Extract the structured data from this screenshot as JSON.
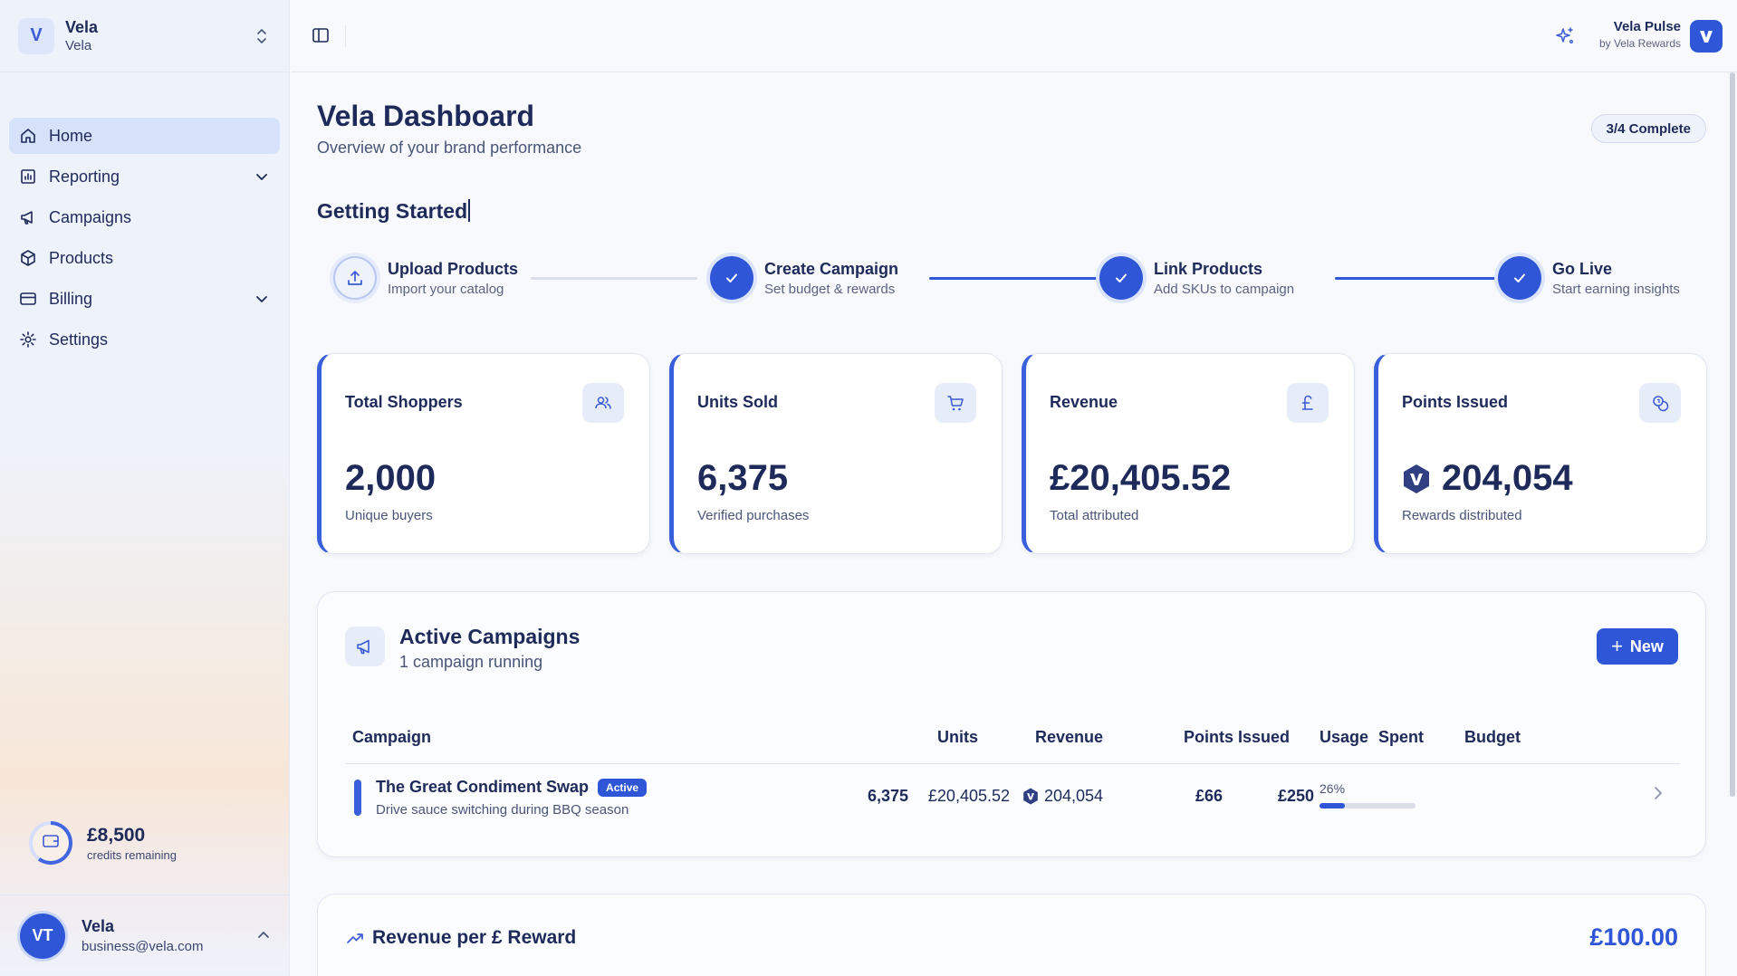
{
  "sidebar": {
    "brand": {
      "initial": "V",
      "name": "Vela",
      "sub": "Vela"
    },
    "nav": [
      {
        "label": "Home",
        "icon": "home-icon"
      },
      {
        "label": "Reporting",
        "icon": "report-icon"
      },
      {
        "label": "Campaigns",
        "icon": "megaphone-icon"
      },
      {
        "label": "Products",
        "icon": "package-icon"
      },
      {
        "label": "Billing",
        "icon": "credit-card-icon"
      },
      {
        "label": "Settings",
        "icon": "gear-icon"
      }
    ],
    "credits": {
      "amount": "£8,500",
      "label": "credits remaining"
    },
    "user": {
      "initials": "VT",
      "name": "Vela",
      "email": "business@vela.com"
    }
  },
  "topbar": {
    "pulse_name": "Vela Pulse",
    "pulse_sub": "by Vela Rewards"
  },
  "page": {
    "title": "Vela Dashboard",
    "subtitle": "Overview of your brand performance",
    "progress": "3/4 Complete"
  },
  "getting_started": {
    "title": "Getting Started",
    "steps": [
      {
        "title": "Upload Products",
        "desc": "Import your catalog",
        "done": false
      },
      {
        "title": "Create Campaign",
        "desc": "Set budget & rewards",
        "done": true
      },
      {
        "title": "Link Products",
        "desc": "Add SKUs to campaign",
        "done": true
      },
      {
        "title": "Go Live",
        "desc": "Start earning insights",
        "done": true
      }
    ]
  },
  "stats": [
    {
      "label": "Total Shoppers",
      "value": "2,000",
      "sub": "Unique buyers",
      "icon": "users-icon"
    },
    {
      "label": "Units Sold",
      "value": "6,375",
      "sub": "Verified purchases",
      "icon": "cart-icon"
    },
    {
      "label": "Revenue",
      "value": "£20,405.52",
      "sub": "Total attributed",
      "icon": "pound-icon"
    },
    {
      "label": "Points Issued",
      "value": "204,054",
      "sub": "Rewards distributed",
      "icon": "coins-icon"
    }
  ],
  "campaigns": {
    "title": "Active Campaigns",
    "sub": "1 campaign running",
    "new_label": "New",
    "columns": [
      "Campaign",
      "Units",
      "Revenue",
      "Points Issued",
      "Spent",
      "Budget",
      "Usage"
    ],
    "rows": [
      {
        "name": "The Great Condiment Swap",
        "status": "Active",
        "desc": "Drive sauce switching during BBQ season",
        "units": "6,375",
        "revenue": "£20,405.52",
        "points": "204,054",
        "spent": "£66",
        "budget": "£250",
        "usage_label": "26%",
        "usage_fraction": 0.26
      }
    ]
  },
  "revenue_per_reward": {
    "title": "Revenue per £ Reward",
    "value": "£100.00"
  },
  "colors": {
    "accent": "#2f56d6",
    "text": "#1e2a5a",
    "muted": "#4a5578"
  }
}
